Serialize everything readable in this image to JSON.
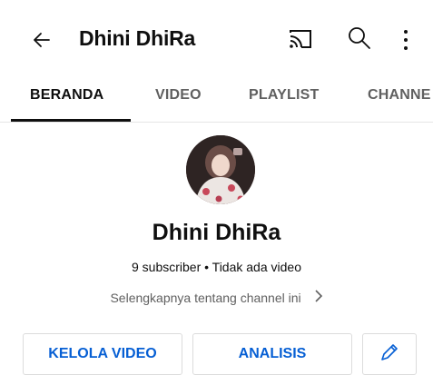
{
  "header": {
    "title": "Dhini DhiRa",
    "icons": [
      "back-arrow-icon",
      "cast-icon",
      "search-icon",
      "more-vert-icon"
    ]
  },
  "tabs": [
    {
      "label": "BERANDA",
      "active": true
    },
    {
      "label": "VIDEO",
      "active": false
    },
    {
      "label": "PLAYLIST",
      "active": false
    },
    {
      "label": "CHANNE",
      "active": false
    }
  ],
  "channel": {
    "name": "Dhini DhiRa",
    "meta": "9 subscriber • Tidak ada video",
    "about": "Selengkapnya tentang channel ini"
  },
  "actions": {
    "manage_videos": "KELOLA VIDEO",
    "analytics": "ANALISIS",
    "edit_icon": "pencil-icon"
  },
  "colors": {
    "accent": "#065fd4",
    "text": "#0f0f0f",
    "secondary": "#606060"
  }
}
